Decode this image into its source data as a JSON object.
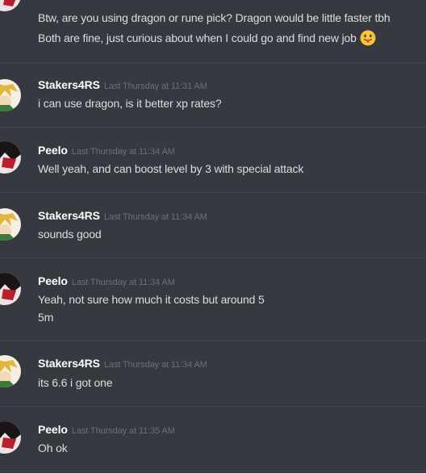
{
  "messages": [
    {
      "author": "",
      "timestamp": "",
      "lines": [
        "Btw, are you using dragon or rune pick? Dragon would be little faster tbh",
        "Both are fine, just curious about when I could go and find new job"
      ],
      "emoji": "face-with-tongue-emoji"
    },
    {
      "author": "Stakers4RS",
      "timestamp": "Last Thursday at 11:31 AM",
      "lines": [
        "i can use dragon, is it better xp rates?"
      ]
    },
    {
      "author": "Peelo",
      "timestamp": "Last Thursday at 11:34 AM",
      "lines": [
        "Well yeah, and can boost level by 3 with special attack"
      ]
    },
    {
      "author": "Stakers4RS",
      "timestamp": "Last Thursday at 11:34 AM",
      "lines": [
        "sounds good"
      ]
    },
    {
      "author": "Peelo",
      "timestamp": "Last Thursday at 11:34 AM",
      "lines": [
        "Yeah, not sure how much it costs but around 5",
        "5m"
      ]
    },
    {
      "author": "Stakers4RS",
      "timestamp": "Last Thursday at 11:34 AM",
      "lines": [
        "its 6.6 i got one"
      ]
    },
    {
      "author": "Peelo",
      "timestamp": "Last Thursday at 11:35 AM",
      "lines": [
        "Oh ok"
      ]
    }
  ],
  "colors": {
    "background": "#36393f",
    "username": "#ffffff",
    "message_text": "#dcddde",
    "timestamp": "#6b6f77",
    "divider": "#40434a"
  }
}
